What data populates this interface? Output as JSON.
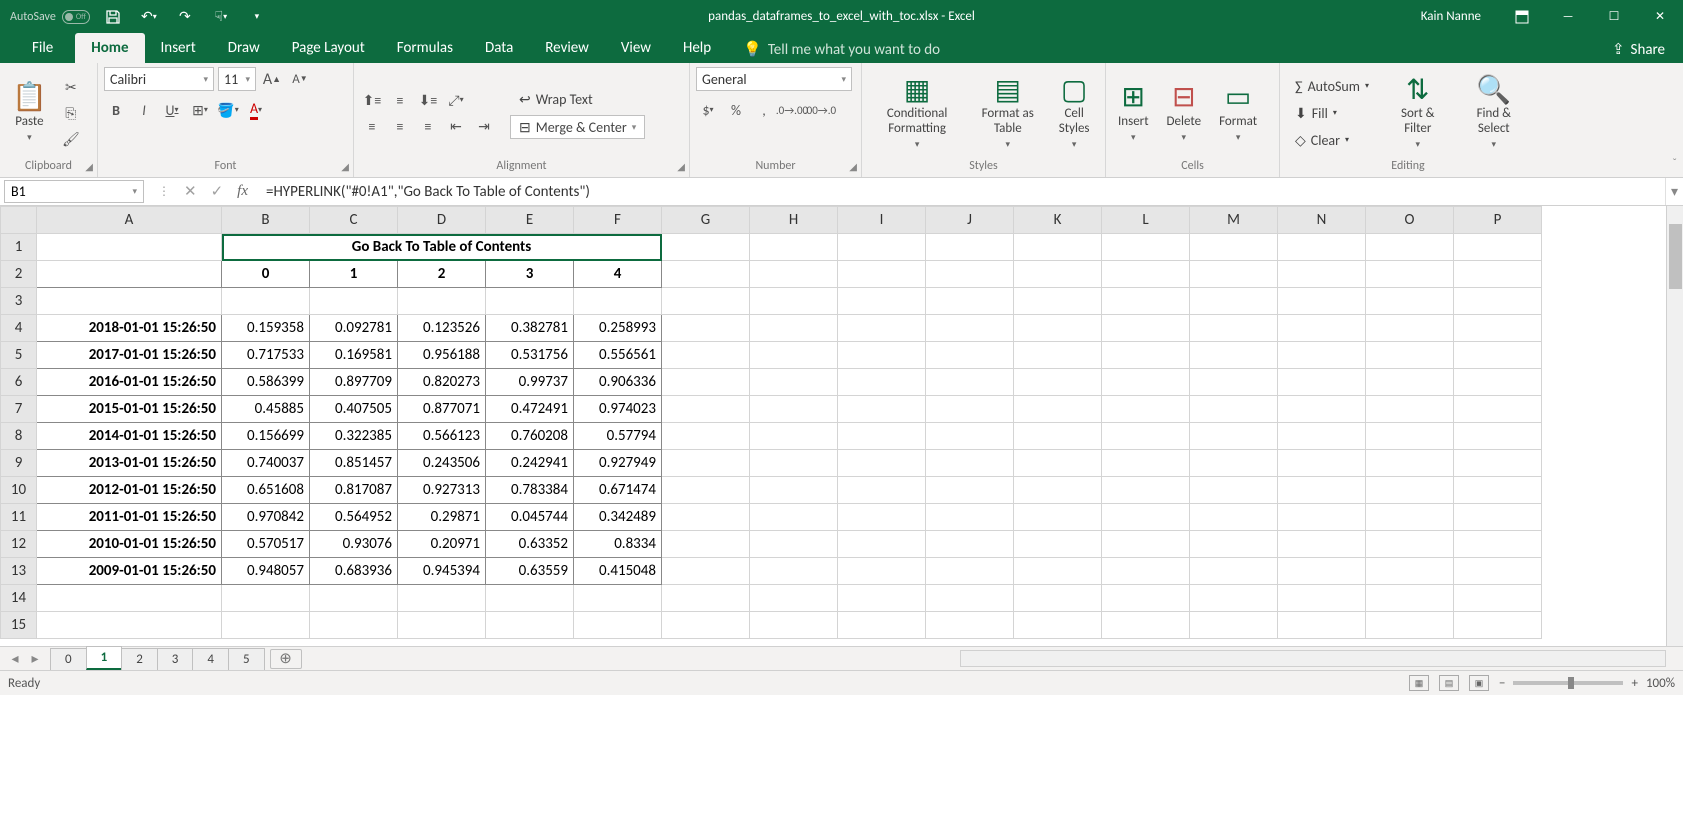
{
  "titlebar": {
    "autosave": "AutoSave",
    "autosave_state": "Off",
    "title": "pandas_dataframes_to_excel_with_toc.xlsx - Excel",
    "user": "Kain Nanne"
  },
  "tabs": {
    "file": "File",
    "home": "Home",
    "insert": "Insert",
    "draw": "Draw",
    "page_layout": "Page Layout",
    "formulas": "Formulas",
    "data": "Data",
    "review": "Review",
    "view": "View",
    "help": "Help",
    "tellme": "Tell me what you want to do",
    "share": "Share"
  },
  "ribbon": {
    "clipboard": {
      "label": "Clipboard",
      "paste": "Paste"
    },
    "font": {
      "label": "Font",
      "name": "Calibri",
      "size": "11"
    },
    "alignment": {
      "label": "Alignment",
      "wrap": "Wrap Text",
      "merge": "Merge & Center"
    },
    "number": {
      "label": "Number",
      "format": "General"
    },
    "styles": {
      "label": "Styles",
      "cond": "Conditional Formatting",
      "table": "Format as Table",
      "cell": "Cell Styles"
    },
    "cells": {
      "label": "Cells",
      "insert": "Insert",
      "delete": "Delete",
      "format": "Format"
    },
    "editing": {
      "label": "Editing",
      "autosum": "AutoSum",
      "fill": "Fill",
      "clear": "Clear",
      "sort": "Sort & Filter",
      "find": "Find & Select"
    }
  },
  "formula_bar": {
    "cell_ref": "B1",
    "formula": "=HYPERLINK(\"#0!A1\",\"Go Back To Table of Contents\")"
  },
  "grid": {
    "link_text": "Go Back To Table of Contents",
    "col_headers": [
      "A",
      "B",
      "C",
      "D",
      "E",
      "F",
      "G",
      "H",
      "I",
      "J",
      "K",
      "L",
      "M",
      "N",
      "O",
      "P"
    ],
    "row_headers": [
      1,
      2,
      3,
      4,
      5,
      6,
      7,
      8,
      9,
      10,
      11,
      12,
      13,
      14,
      15
    ],
    "data_cols": [
      "0",
      "1",
      "2",
      "3",
      "4"
    ],
    "rows": [
      {
        "ts": "2018-01-01 15:26:50",
        "v": [
          "0.159358",
          "0.092781",
          "0.123526",
          "0.382781",
          "0.258993"
        ]
      },
      {
        "ts": "2017-01-01 15:26:50",
        "v": [
          "0.717533",
          "0.169581",
          "0.956188",
          "0.531756",
          "0.556561"
        ]
      },
      {
        "ts": "2016-01-01 15:26:50",
        "v": [
          "0.586399",
          "0.897709",
          "0.820273",
          "0.99737",
          "0.906336"
        ]
      },
      {
        "ts": "2015-01-01 15:26:50",
        "v": [
          "0.45885",
          "0.407505",
          "0.877071",
          "0.472491",
          "0.974023"
        ]
      },
      {
        "ts": "2014-01-01 15:26:50",
        "v": [
          "0.156699",
          "0.322385",
          "0.566123",
          "0.760208",
          "0.57794"
        ]
      },
      {
        "ts": "2013-01-01 15:26:50",
        "v": [
          "0.740037",
          "0.851457",
          "0.243506",
          "0.242941",
          "0.927949"
        ]
      },
      {
        "ts": "2012-01-01 15:26:50",
        "v": [
          "0.651608",
          "0.817087",
          "0.927313",
          "0.783384",
          "0.671474"
        ]
      },
      {
        "ts": "2011-01-01 15:26:50",
        "v": [
          "0.970842",
          "0.564952",
          "0.29871",
          "0.045744",
          "0.342489"
        ]
      },
      {
        "ts": "2010-01-01 15:26:50",
        "v": [
          "0.570517",
          "0.93076",
          "0.20971",
          "0.63352",
          "0.8334"
        ]
      },
      {
        "ts": "2009-01-01 15:26:50",
        "v": [
          "0.948057",
          "0.683936",
          "0.945394",
          "0.63559",
          "0.415048"
        ]
      }
    ]
  },
  "sheets": {
    "list": [
      "0",
      "1",
      "2",
      "3",
      "4",
      "5"
    ],
    "active": "1"
  },
  "status": {
    "ready": "Ready",
    "zoom": "100%"
  }
}
